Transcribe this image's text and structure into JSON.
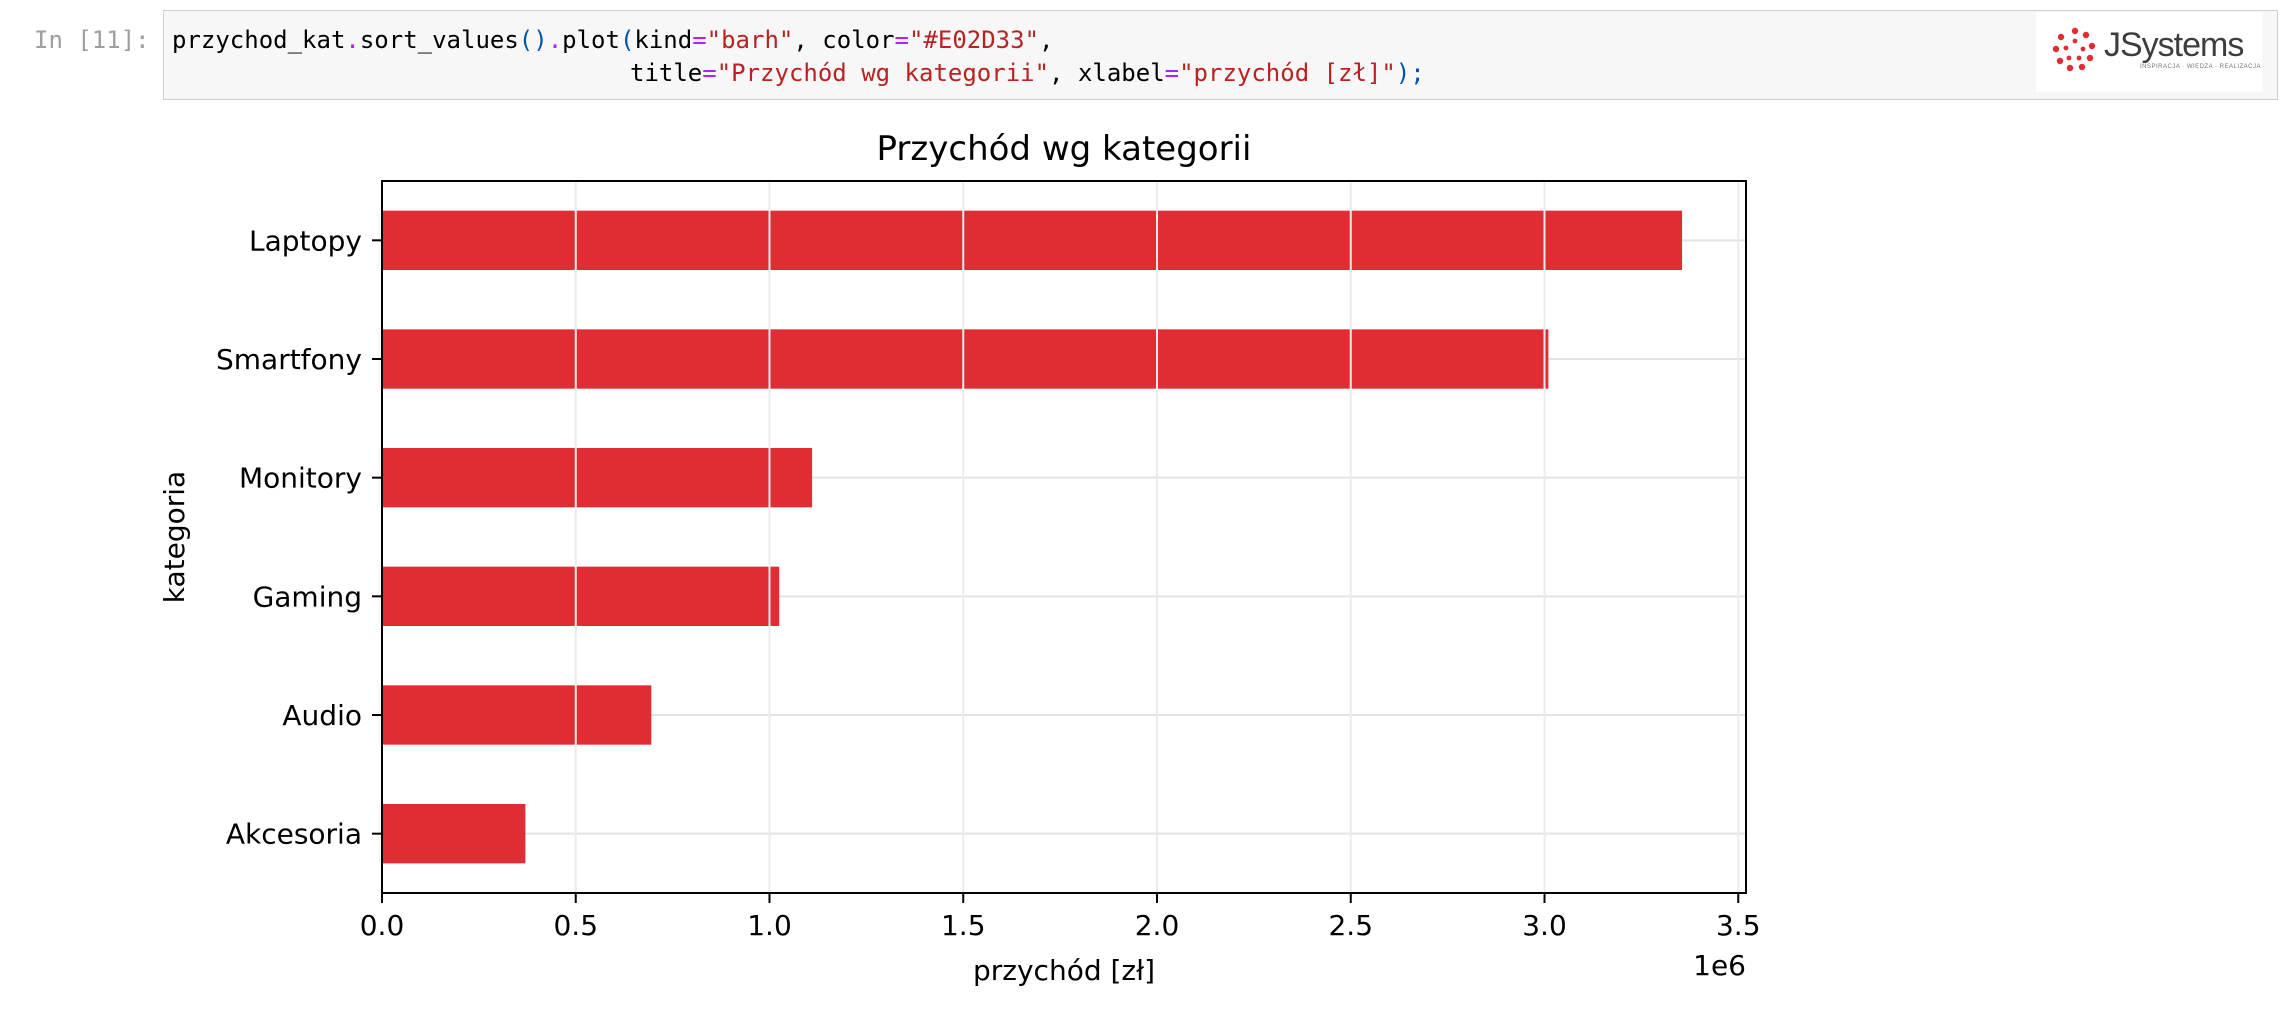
{
  "cell": {
    "prompt": "In [11]:",
    "code": {
      "l1_a": "przychod_kat",
      "l1_dot1": ".",
      "l1_b": "sort_values",
      "l1_paren1": "()",
      "l1_dot2": ".",
      "l1_c": "plot",
      "l1_open": "(",
      "l1_d": "kind",
      "l1_eq1": "=",
      "l1_s1": "\"barh\"",
      "l1_e": ", color",
      "l1_eq2": "=",
      "l1_s2": "\"#E02D33\"",
      "l1_f": ",",
      "l2_a": "title",
      "l2_eq1": "=",
      "l2_s1": "\"Przychód wg kategorii\"",
      "l2_b": ", xlabel",
      "l2_eq2": "=",
      "l2_s2": "\"przychód [zł]\"",
      "l2_close": ");"
    }
  },
  "logo": {
    "text": "JSystems",
    "tagline": "INSPIRACJA · WIEDZA · REALIZACJA"
  },
  "chart_data": {
    "type": "bar",
    "orientation": "horizontal",
    "title": "Przychód wg kategorii",
    "xlabel": "przychód [zł]",
    "ylabel": "kategoria",
    "offset_label": "1e6",
    "categories": [
      "Akcesoria",
      "Audio",
      "Gaming",
      "Monitory",
      "Smartfony",
      "Laptopy"
    ],
    "values": [
      370000,
      695000,
      1025000,
      1110000,
      3010000,
      3355000
    ],
    "xlim": [
      0,
      3.52
    ],
    "xticks": [
      "0.0",
      "0.5",
      "1.0",
      "1.5",
      "2.0",
      "2.5",
      "3.0",
      "3.5"
    ],
    "grid": true,
    "bar_color": "#E02D33"
  }
}
